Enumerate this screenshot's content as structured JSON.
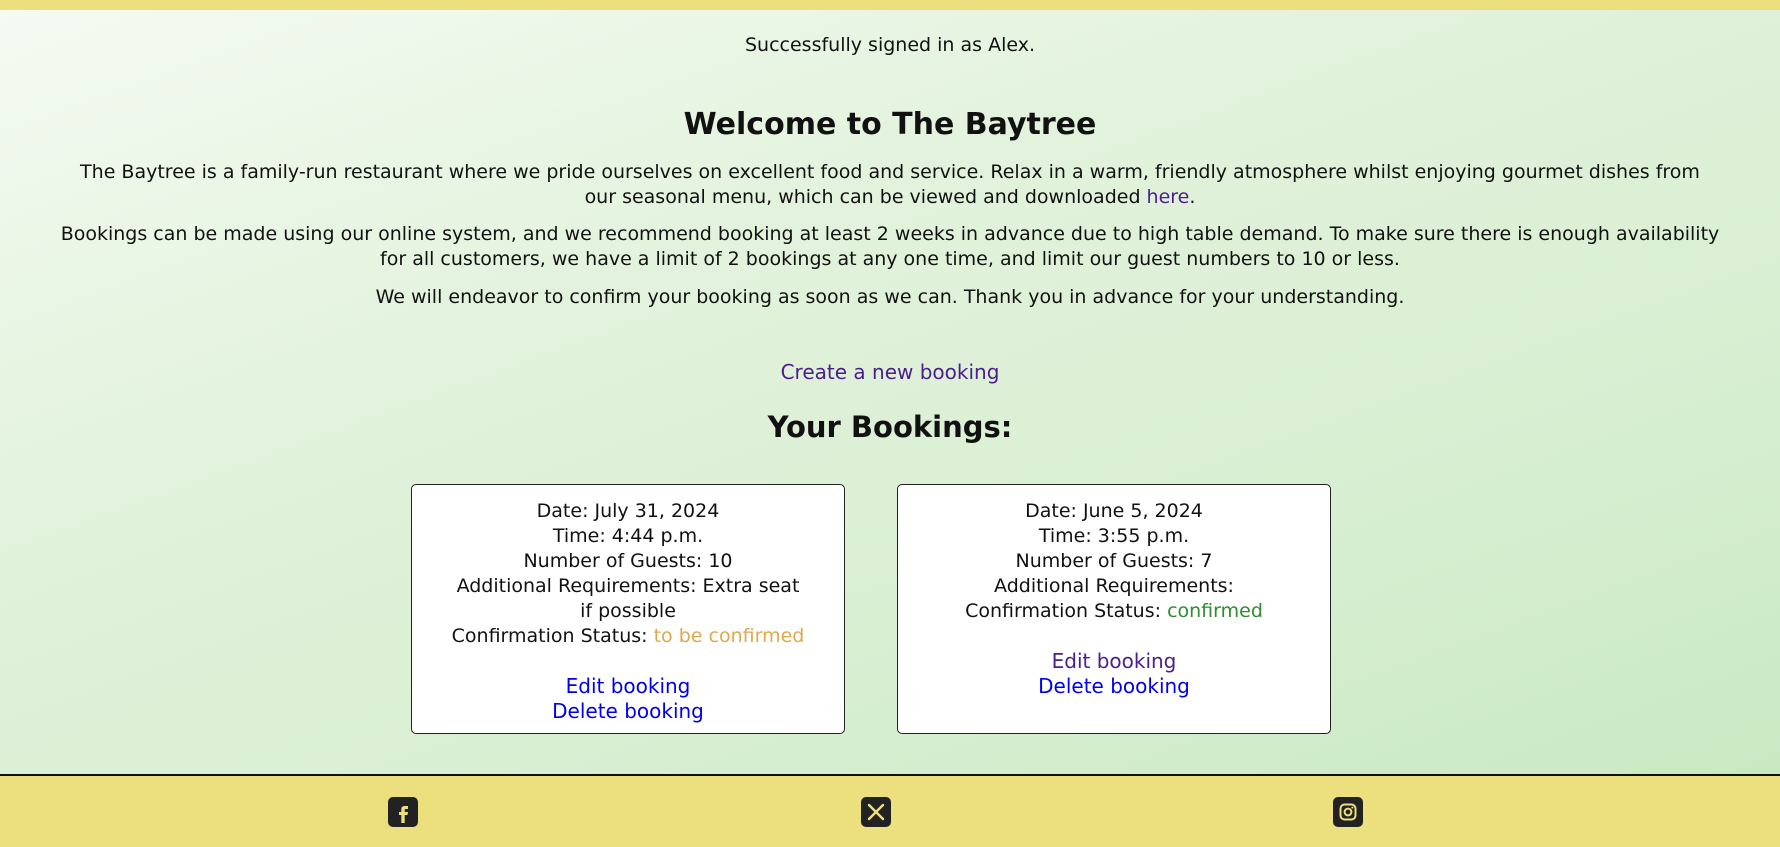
{
  "flash_message": "Successfully signed in as Alex.",
  "welcome": {
    "title": "Welcome to The Baytree",
    "p1_text": "The Baytree is a family-run restaurant where we pride ourselves on excellent food and service. Relax in a warm, friendly atmosphere whilst enjoying gourmet dishes from our seasonal menu, which can be viewed and downloaded ",
    "p1_link": "here",
    "p1_end": ".",
    "p2": "Bookings can be made using our online system, and we recommend booking at least 2 weeks in advance due to high table demand. To make sure there is enough availability for all customers, we have a limit of 2 bookings at any one time, and limit our guest numbers to 10 or less.",
    "p3": "We will endeavor to confirm your booking as soon as we can. Thank you in advance for your understanding."
  },
  "create_booking_link": "Create a new booking",
  "bookings_title": "Your Bookings:",
  "bookings": [
    {
      "date": "Date: July 31, 2024",
      "time": "Time: 4:44 p.m.",
      "guests": "Number of Guests: 10",
      "requirements": "Additional Requirements: Extra seat if possible",
      "status_label": "Confirmation Status: ",
      "status_value": "to be confirmed",
      "edit_label": "Edit booking",
      "delete_label": "Delete booking"
    },
    {
      "date": "Date: June 5, 2024",
      "time": "Time: 3:55 p.m.",
      "guests": "Number of Guests: 7",
      "requirements": "Additional Requirements:",
      "status_label": "Confirmation Status: ",
      "status_value": "confirmed",
      "edit_label": "Edit booking",
      "delete_label": "Delete booking"
    }
  ],
  "footer": {
    "icons": [
      "facebook-icon",
      "x-twitter-icon",
      "instagram-icon"
    ]
  },
  "colors": {
    "accent_yellow": "#ebdf7e",
    "link_purple": "#4b1d8f",
    "link_blue": "#0000ee",
    "status_pending": "#e0a84a",
    "status_confirmed": "#2e8b2e"
  }
}
